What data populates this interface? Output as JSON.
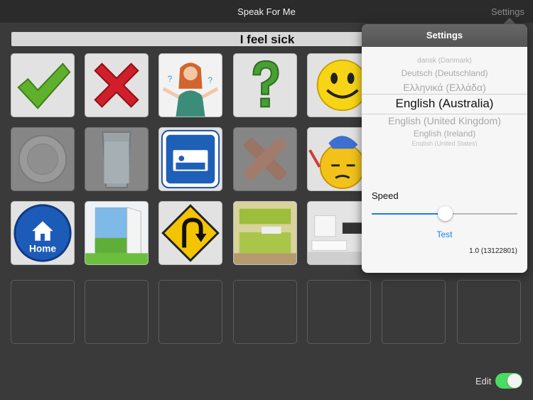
{
  "header": {
    "title": "Speak For Me",
    "settings_label": "Settings"
  },
  "sentence": "I feel sick",
  "tiles": [
    {
      "icon": "checkmark-icon"
    },
    {
      "icon": "cross-icon"
    },
    {
      "icon": "confused-girl-icon"
    },
    {
      "icon": "question-mark-icon"
    },
    {
      "icon": "smiley-icon"
    },
    {
      "icon": "plate-icon"
    },
    {
      "icon": "glass-icon"
    },
    {
      "icon": "bed-sign-icon"
    },
    {
      "icon": "bandage-icon"
    },
    {
      "icon": "sick-face-icon"
    },
    {
      "icon": "home-button-icon",
      "label": "Home"
    },
    {
      "icon": "open-door-icon"
    },
    {
      "icon": "u-turn-sign-icon"
    },
    {
      "icon": "kitchen-icon"
    },
    {
      "icon": "living-room-icon"
    }
  ],
  "settings": {
    "title": "Settings",
    "languages": [
      "dansk (Danmark)",
      "Deutsch (Deutschland)",
      "Ελληνικά (Ελλάδα)",
      "English (Australia)",
      "English (United Kingdom)",
      "English (Ireland)",
      "English (United States)"
    ],
    "selected_language": "English (Australia)",
    "speed_label": "Speed",
    "speed_value": 0.5,
    "test_label": "Test",
    "version": "1.0 (13122801)"
  },
  "edit": {
    "label": "Edit",
    "on": true
  },
  "colors": {
    "accent": "#1a7ef5",
    "toggle_on": "#4cd964",
    "background": "#3a3a3a"
  }
}
